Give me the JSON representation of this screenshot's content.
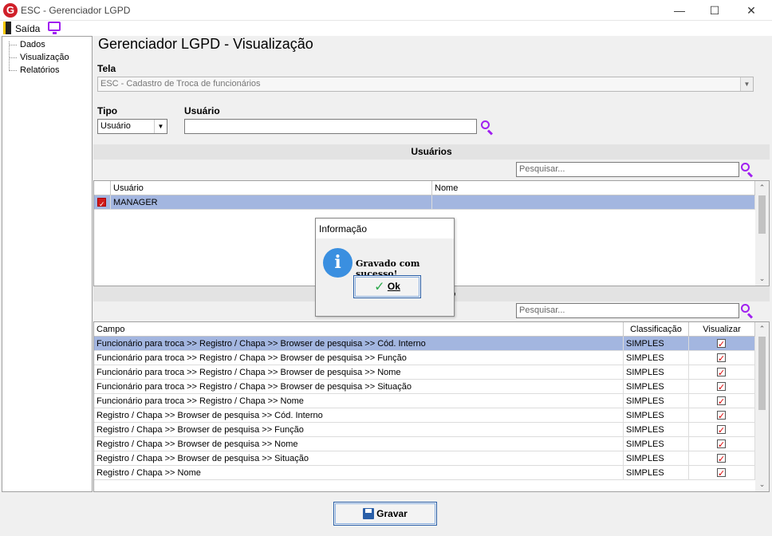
{
  "window": {
    "title": "ESC - Gerenciador LGPD",
    "app_icon_letter": "G"
  },
  "menu": {
    "exit_label": "Saída"
  },
  "tree": {
    "items": [
      "Dados",
      "Visualização",
      "Relatórios"
    ]
  },
  "page": {
    "title": "Gerenciador LGPD - Visualização"
  },
  "form": {
    "tela_label": "Tela",
    "tela_value": "ESC - Cadastro de Troca de funcionários",
    "tipo_label": "Tipo",
    "tipo_value": "Usuário",
    "usuario_label": "Usuário",
    "usuario_value": ""
  },
  "users_section": {
    "title": "Usuários",
    "search_placeholder": "Pesquisar...",
    "columns": [
      "Usuário",
      "Nome"
    ],
    "rows": [
      {
        "usuario": "MANAGER",
        "nome": "",
        "checked": true
      }
    ]
  },
  "fields_section": {
    "title": "o",
    "search_placeholder": "Pesquisar...",
    "columns": [
      "Campo",
      "Classificação",
      "Visualizar"
    ],
    "rows": [
      {
        "campo": "Funcionário para troca >> Registro / Chapa  >> Browser de pesquisa >> Cód. Interno",
        "classificacao": "SIMPLES",
        "visualizar": true
      },
      {
        "campo": "Funcionário para troca >> Registro / Chapa  >> Browser de pesquisa >> Função",
        "classificacao": "SIMPLES",
        "visualizar": true
      },
      {
        "campo": "Funcionário para troca >> Registro / Chapa  >> Browser de pesquisa >> Nome",
        "classificacao": "SIMPLES",
        "visualizar": true
      },
      {
        "campo": "Funcionário para troca >> Registro / Chapa  >> Browser de pesquisa >> Situação",
        "classificacao": "SIMPLES",
        "visualizar": true
      },
      {
        "campo": "Funcionário para troca >> Registro / Chapa >> Nome",
        "classificacao": "SIMPLES",
        "visualizar": true
      },
      {
        "campo": "Registro / Chapa >> Browser de pesquisa >> Cód. Interno",
        "classificacao": "SIMPLES",
        "visualizar": true
      },
      {
        "campo": "Registro / Chapa >> Browser de pesquisa >> Função",
        "classificacao": "SIMPLES",
        "visualizar": true
      },
      {
        "campo": "Registro / Chapa >> Browser de pesquisa >> Nome",
        "classificacao": "SIMPLES",
        "visualizar": true
      },
      {
        "campo": "Registro / Chapa >> Browser de pesquisa >> Situação",
        "classificacao": "SIMPLES",
        "visualizar": true
      },
      {
        "campo": "Registro / Chapa >> Nome",
        "classificacao": "SIMPLES",
        "visualizar": true
      }
    ]
  },
  "dialog": {
    "title": "Informação",
    "message": "Gravado com sucesso!",
    "ok_label": "Ok"
  },
  "footer": {
    "save_label": "Gravar"
  },
  "colors": {
    "selection": "#a3b6e0",
    "accent_purple": "#a020f0",
    "button_border": "#2a5fa8",
    "check_red": "#d01a1a"
  }
}
